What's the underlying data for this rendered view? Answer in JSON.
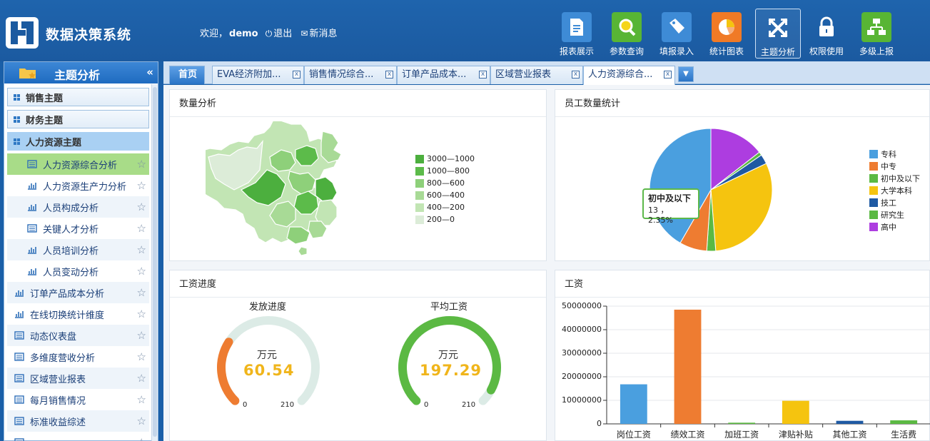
{
  "header": {
    "app_title": "数据决策系统",
    "welcome_prefix": "欢迎，",
    "username": "demo",
    "logout_label": "退出",
    "messages_label": "新消息",
    "tools": [
      {
        "label": "报表展示",
        "icon": "report-doc-icon",
        "color": "#3e8bd6"
      },
      {
        "label": "参数查询",
        "icon": "magnifier-icon",
        "color": "#58b534"
      },
      {
        "label": "填报录入",
        "icon": "tag-icon",
        "color": "#3e8bd6"
      },
      {
        "label": "统计图表",
        "icon": "pie-chart-icon",
        "color": "#f07a26"
      },
      {
        "label": "主题分析",
        "icon": "expand-arrows-icon",
        "color": "#1d5fa7"
      },
      {
        "label": "权限使用",
        "icon": "lock-icon",
        "color": "#1d5fa7"
      },
      {
        "label": "多级上报",
        "icon": "org-tree-icon",
        "color": "#58b534"
      }
    ]
  },
  "sidebar": {
    "title": "主题分析",
    "collapse_glyph": "«",
    "groups": [
      {
        "label": "销售主题"
      },
      {
        "label": "财务主题"
      },
      {
        "label": "人力资源主题"
      }
    ],
    "sub_items": [
      {
        "label": "人力资源综合分析",
        "icon": "form-icon"
      },
      {
        "label": "人力资源生产力分析",
        "icon": "bar-icon"
      },
      {
        "label": "人员构成分析",
        "icon": "bar-icon"
      },
      {
        "label": "关键人才分析",
        "icon": "form-icon"
      },
      {
        "label": "人员培训分析",
        "icon": "bar-icon"
      },
      {
        "label": "人员变动分析",
        "icon": "bar-icon"
      }
    ],
    "top_items": [
      {
        "label": "订单产品成本分析",
        "icon": "bar-icon"
      },
      {
        "label": "在线切换统计维度",
        "icon": "bar-icon"
      },
      {
        "label": "动态仪表盘",
        "icon": "form-icon"
      },
      {
        "label": "多维度营收分析",
        "icon": "form-icon"
      },
      {
        "label": "区域营业报表",
        "icon": "form-icon"
      },
      {
        "label": "每月销售情况",
        "icon": "form-icon"
      },
      {
        "label": "标准收益综述",
        "icon": "form-icon"
      },
      {
        "label": "",
        "icon": "form-icon"
      }
    ]
  },
  "tabs": {
    "home": "首页",
    "items": [
      {
        "label": "EVA经济附加..."
      },
      {
        "label": "销售情况综合..."
      },
      {
        "label": "订单产品成本..."
      },
      {
        "label": "区域营业报表"
      },
      {
        "label": "人力资源综合..."
      }
    ],
    "close_glyph": "x",
    "more_glyph": "▼"
  },
  "panels": {
    "map": {
      "title": "数量分析",
      "legend": [
        {
          "label": "3000—1000",
          "color": "#4caf3e"
        },
        {
          "label": "1000—800",
          "color": "#5cbb4a"
        },
        {
          "label": "800—600",
          "color": "#8ed07a"
        },
        {
          "label": "600—400",
          "color": "#a8da96"
        },
        {
          "label": "400—200",
          "color": "#c2e5b4"
        },
        {
          "label": "200—0",
          "color": "#dcecd8"
        }
      ]
    },
    "pie": {
      "title": "员工数量统计",
      "legend": [
        {
          "label": "专科",
          "color": "#4a9fdf"
        },
        {
          "label": "中专",
          "color": "#ee7c31"
        },
        {
          "label": "初中及以下",
          "color": "#5bb943"
        },
        {
          "label": "大学本科",
          "color": "#f5c40f"
        },
        {
          "label": "技工",
          "color": "#1f5aa3"
        },
        {
          "label": "研究生",
          "color": "#5bb943"
        },
        {
          "label": "高中",
          "color": "#ad3de0"
        }
      ],
      "tooltip": {
        "title": "初中及以下",
        "value": "13 ，  2.35%"
      }
    },
    "gauge": {
      "title": "工资进度",
      "gauges": [
        {
          "title": "发放进度",
          "unit": "万元",
          "value": "60.54",
          "min": "0",
          "max": "210",
          "fraction": 0.2883,
          "color": "#ee7c31"
        },
        {
          "title": "平均工资",
          "unit": "万元",
          "value": "197.29",
          "min": "0",
          "max": "210",
          "fraction": 0.9395,
          "color": "#5bb943"
        }
      ]
    },
    "bar": {
      "title": "工资"
    }
  },
  "chart_data": [
    {
      "type": "pie",
      "title": "员工数量统计",
      "series": [
        {
          "name": "专科",
          "value": 230,
          "color": "#4a9fdf"
        },
        {
          "name": "中专",
          "value": 40,
          "color": "#ee7c31"
        },
        {
          "name": "初中及以下",
          "value": 13,
          "color": "#5bb943"
        },
        {
          "name": "大学本科",
          "value": 170,
          "color": "#f5c40f"
        },
        {
          "name": "技工",
          "value": 14,
          "color": "#1f5aa3"
        },
        {
          "name": "研究生",
          "value": 5,
          "color": "#5bb943"
        },
        {
          "name": "高中",
          "value": 80,
          "color": "#ad3de0"
        }
      ],
      "order": [
        "高中",
        "研究生",
        "技工",
        "大学本科",
        "初中及以下",
        "中专",
        "专科"
      ]
    },
    {
      "type": "bar",
      "title": "工资",
      "categories": [
        "岗位工资",
        "绩效工资",
        "加班工资",
        "津贴补贴",
        "其他工资",
        "生活费"
      ],
      "values": [
        16800000,
        48500000,
        500000,
        9800000,
        1300000,
        1500000
      ],
      "colors": [
        "#4a9fdf",
        "#ee7c31",
        "#5bb943",
        "#f5c40f",
        "#1f5aa3",
        "#5bb943"
      ],
      "ylim": [
        0,
        50000000
      ],
      "yticks": [
        "0",
        "10000000",
        "20000000",
        "30000000",
        "40000000",
        "50000000"
      ],
      "grid": true
    }
  ]
}
